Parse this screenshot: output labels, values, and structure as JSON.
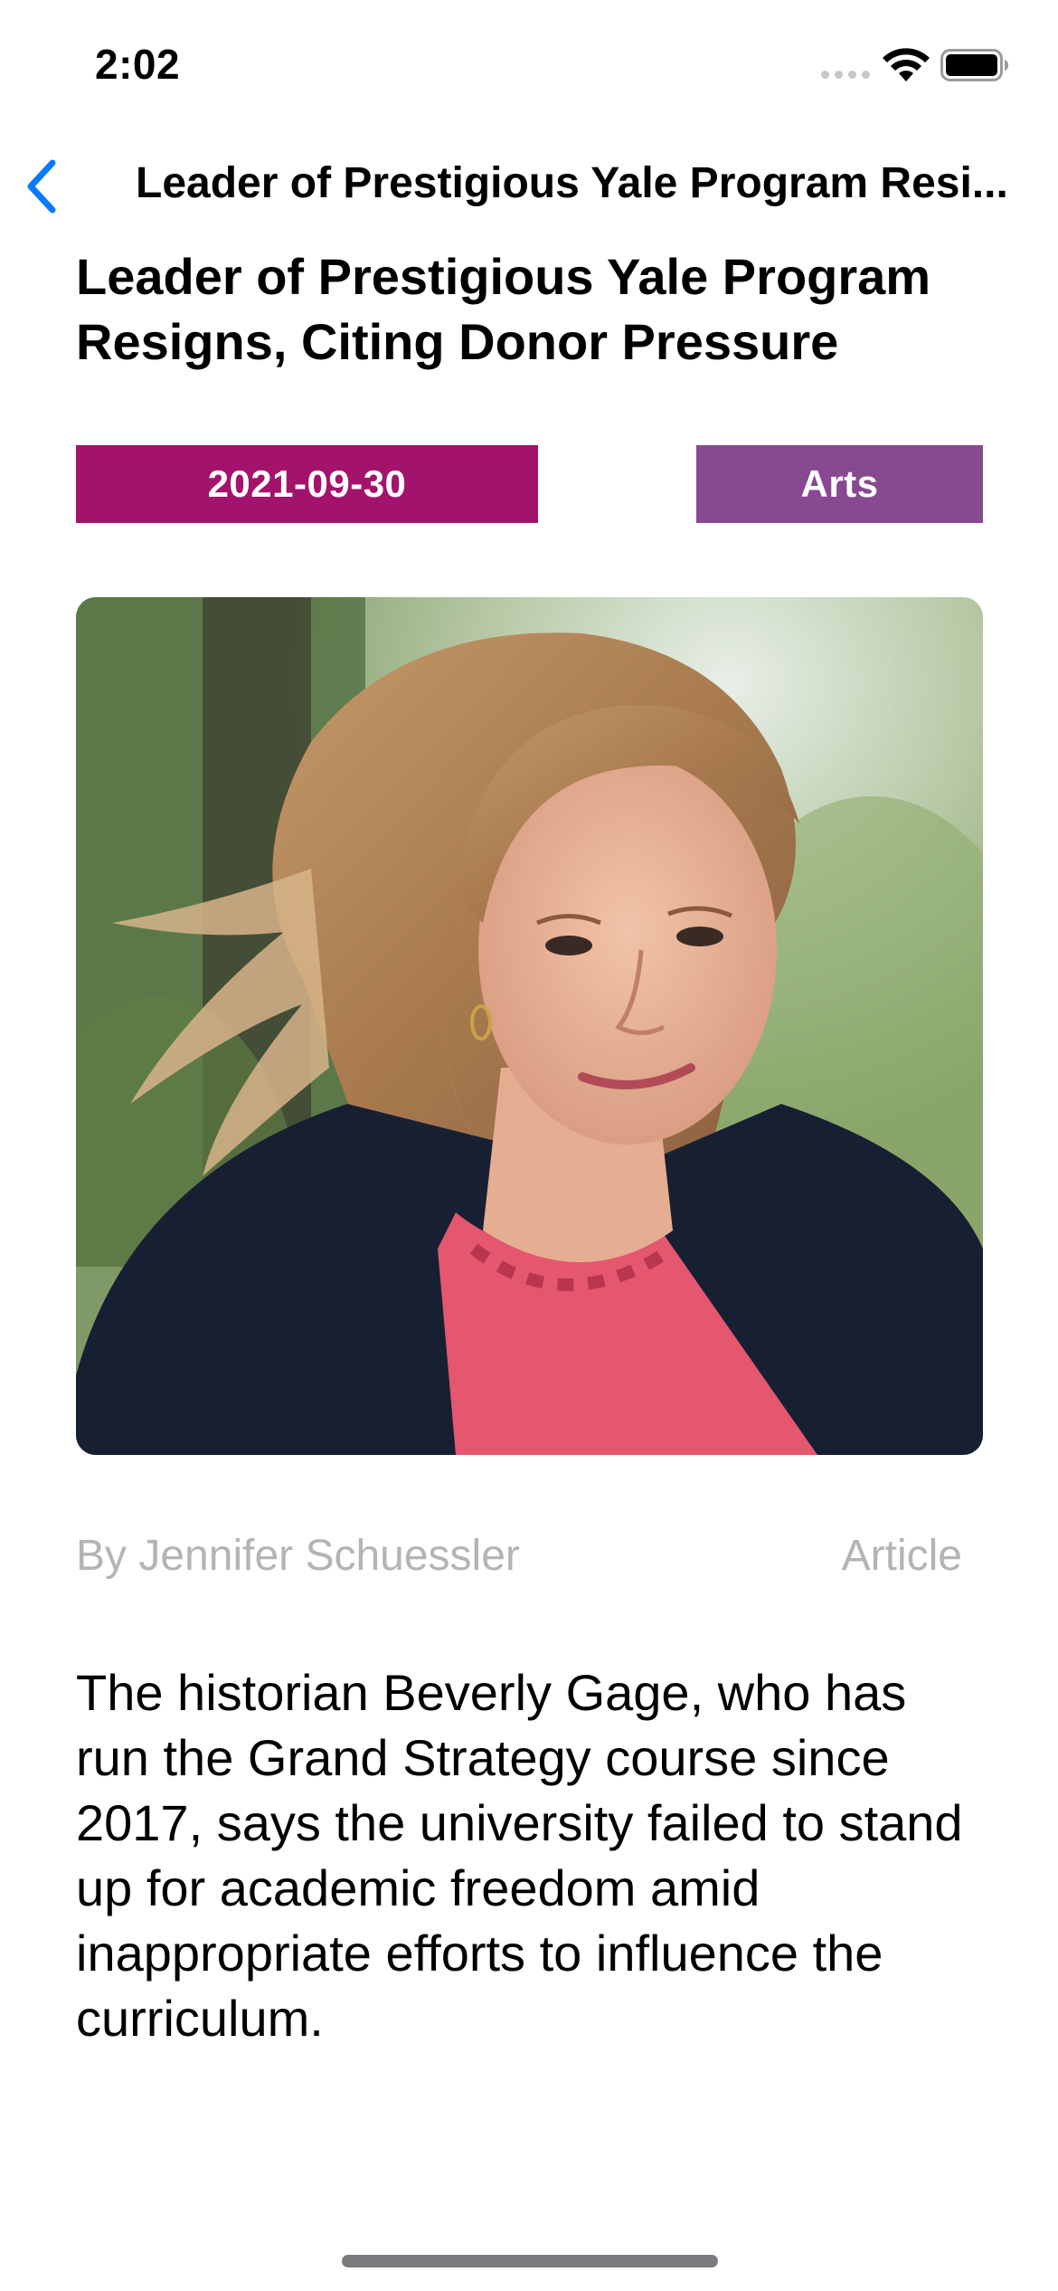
{
  "status_bar": {
    "time": "2:02"
  },
  "nav": {
    "title": "Leader of Prestigious Yale Program Resi...",
    "back_icon": "chevron-left-icon"
  },
  "article": {
    "headline": "Leader of Prestigious Yale Program Resigns, Citing Donor Pressure",
    "date": "2021-09-30",
    "section": "Arts",
    "byline": "By Jennifer Schuessler",
    "content_type": "Article",
    "abstract": "The historian Beverly Gage, who has run the Grand Strategy course since 2017, says the university failed to stand up for academic freedom amid inappropriate efforts to influence the curriculum."
  },
  "colors": {
    "accent": "#0a7aff",
    "date_badge": "#a4136b",
    "section_badge": "#87498f",
    "secondary_text": "#b4b4b8"
  }
}
